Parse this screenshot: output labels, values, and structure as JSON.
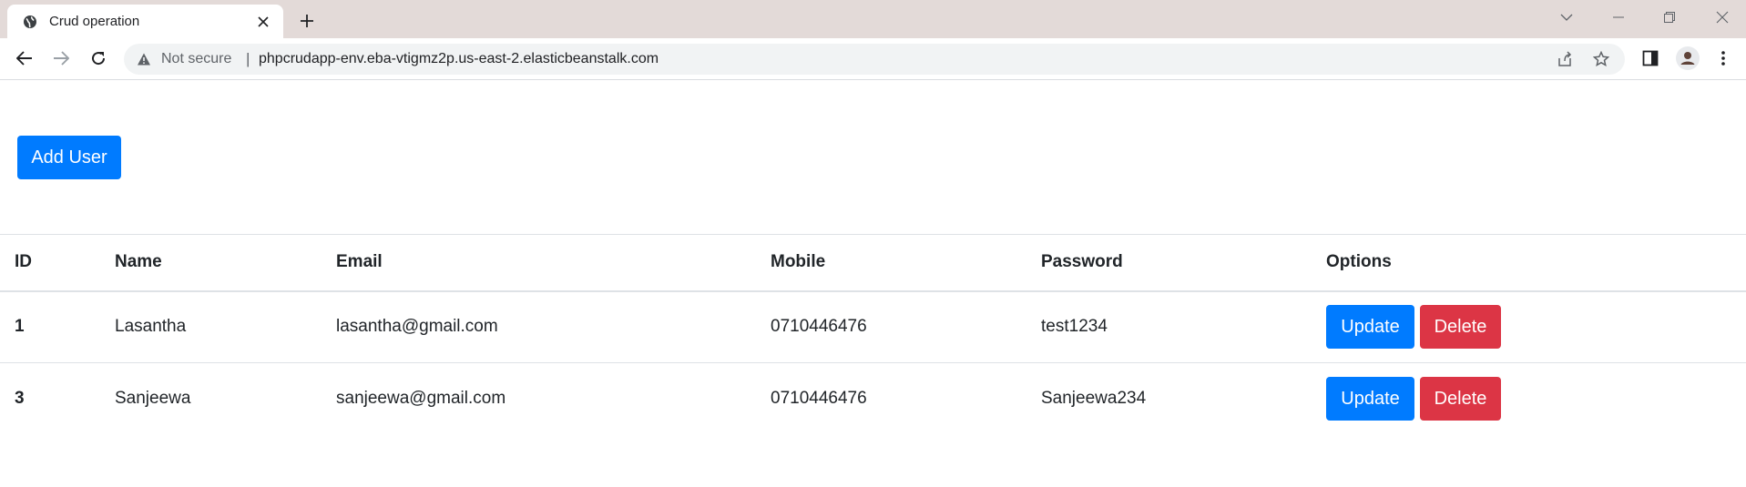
{
  "browser": {
    "tab": {
      "title": "Crud operation",
      "favicon": "globe-icon"
    },
    "new_tab_icon": "plus-icon",
    "window_controls": [
      "chevron-down-icon",
      "minimize-icon",
      "restore-icon",
      "close-icon"
    ],
    "omnibox": {
      "security_label": "Not secure",
      "separator": "|",
      "url": "phpcrudapp-env.eba-vtigmz2p.us-east-2.elasticbeanstalk.com"
    }
  },
  "page": {
    "add_user_label": "Add User",
    "table": {
      "headers": [
        "ID",
        "Name",
        "Email",
        "Mobile",
        "Password",
        "Options"
      ],
      "rows": [
        {
          "id": "1",
          "name": "Lasantha",
          "email": "lasantha@gmail.com",
          "mobile": "0710446476",
          "password": "test1234"
        },
        {
          "id": "3",
          "name": "Sanjeewa",
          "email": "sanjeewa@gmail.com",
          "mobile": "0710446476",
          "password": "Sanjeewa234"
        }
      ],
      "update_label": "Update",
      "delete_label": "Delete"
    }
  },
  "colors": {
    "primary": "#007bff",
    "danger": "#dc3545",
    "tabstrip": "#e3dad8"
  }
}
